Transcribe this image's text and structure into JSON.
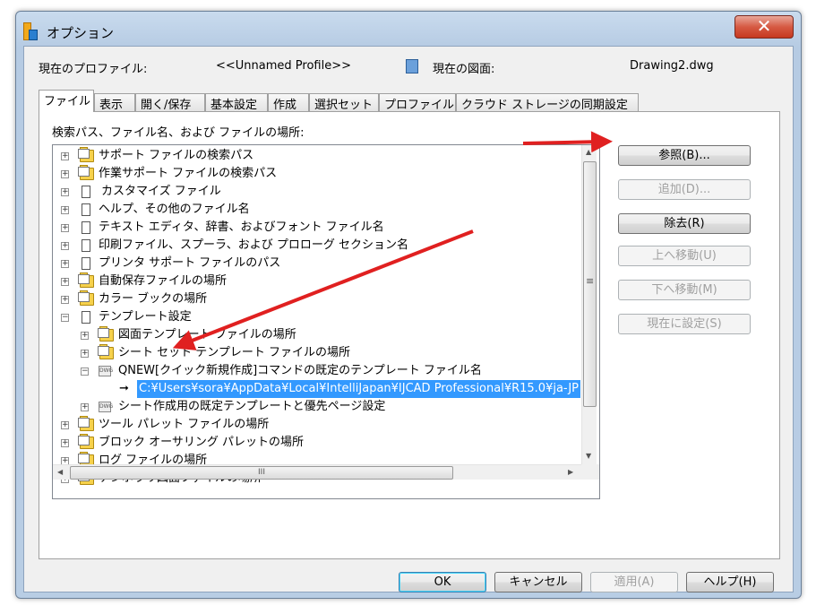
{
  "window": {
    "title": "オプション",
    "close_symbol": "✕"
  },
  "header": {
    "profile_label": "現在のプロファイル:",
    "profile_value": "<<Unnamed Profile>>",
    "drawing_label": "現在の図面:",
    "drawing_value": "Drawing2.dwg"
  },
  "tabs": [
    "ファイル",
    "表示",
    "開く/保存",
    "基本設定",
    "作成",
    "選択セット",
    "プロファイル",
    "クラウド ストレージの同期設定"
  ],
  "panel": {
    "heading": "検索パス、ファイル名、および ファイルの場所:"
  },
  "tree": [
    {
      "label": "サポート ファイルの検索パス"
    },
    {
      "label": "作業サポート ファイルの検索パス"
    },
    {
      "label": "カスタマイズ ファイル"
    },
    {
      "label": "ヘルプ、その他のファイル名"
    },
    {
      "label": "テキスト エディタ、辞書、およびフォント ファイル名"
    },
    {
      "label": "印刷ファイル、スプーラ、および プロローグ セクション名"
    },
    {
      "label": "プリンタ サポート ファイルのパス"
    },
    {
      "label": "自動保存ファイルの場所"
    },
    {
      "label": "カラー ブックの場所"
    },
    {
      "label": "テンプレート設定"
    },
    {
      "label": "図面テンプレート ファイルの場所"
    },
    {
      "label": "シート セット テンプレート ファイルの場所"
    },
    {
      "label": "QNEW[クイック新規作成]コマンドの既定のテンプレート ファイル名"
    },
    {
      "label": "C:¥Users¥sora¥AppData¥Local¥IntelliJapan¥IJCAD Professional¥R15.0¥ja-JP"
    },
    {
      "label": "シート作成用の既定テンプレートと優先ページ設定"
    },
    {
      "label": "ツール パレット ファイルの場所"
    },
    {
      "label": "ブロック オーサリング パレットの場所"
    },
    {
      "label": "ログ ファイルの場所"
    },
    {
      "label": "テンポラリ図面ファイルの場所"
    }
  ],
  "side_buttons": {
    "browse": "参照(B)...",
    "add": "追加(D)...",
    "remove": "除去(R)",
    "move_up": "上へ移動(U)",
    "move_down": "下へ移動(M)",
    "set_current": "現在に設定(S)"
  },
  "footer_buttons": {
    "ok": "OK",
    "cancel": "キャンセル",
    "apply": "適用(A)",
    "help": "ヘルプ(H)"
  },
  "scroll": {
    "h_thumb": "III",
    "v_thumb": "≡"
  },
  "annotation_color": "#e02020"
}
